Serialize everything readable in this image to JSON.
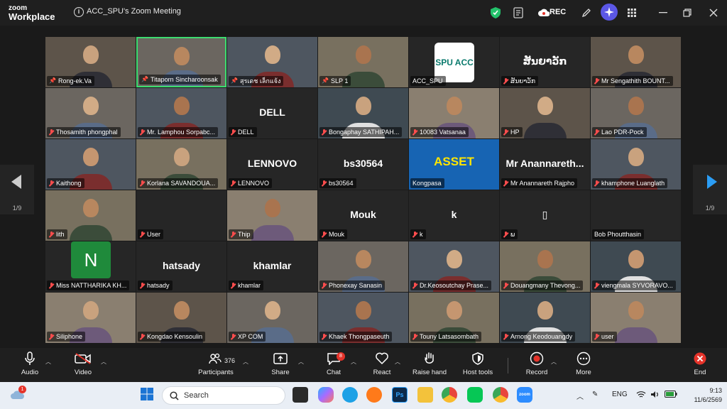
{
  "window": {
    "brand_line1": "zoom",
    "brand_line2": "Workplace",
    "meeting_title": "ACC_SPU's Zoom Meeting",
    "rec_label": "REC"
  },
  "pager": {
    "left": "1/9",
    "right": "1/9"
  },
  "tiles": [
    {
      "label": "Rong-ek.Va",
      "pinned": true,
      "video": true
    },
    {
      "label": "Titaporn Sincharoonsak",
      "pinned": true,
      "video": true,
      "active": true
    },
    {
      "label": "สุรเดช เล็กแจ้ง",
      "pinned": true,
      "video": true
    },
    {
      "label": "SLP 1",
      "pinned": true,
      "video": true
    },
    {
      "label": "ACC_SPU",
      "logo_text": "SPU ACC"
    },
    {
      "label": "ສັນຍາວັກ",
      "muted": true,
      "big_text": "ສັນຍາວັກ"
    },
    {
      "label": "Mr Sengathith BOUNT...",
      "muted": true,
      "video": true
    },
    {
      "label": "Thosamith phongphal",
      "muted": true,
      "video": true
    },
    {
      "label": "Mr. Lamphou Sorpabc...",
      "muted": true,
      "video": true
    },
    {
      "label": "DELL",
      "muted": true,
      "big_text": "DELL"
    },
    {
      "label": "Bongaphay SATHIPAH...",
      "muted": true,
      "video": true
    },
    {
      "label": "10083 Vatsanaa",
      "muted": true,
      "video": true
    },
    {
      "label": "HP",
      "muted": true,
      "video": true
    },
    {
      "label": "Lao PDR-Pock",
      "muted": true,
      "video": true
    },
    {
      "label": "Kaithong",
      "muted": true,
      "video": true
    },
    {
      "label": "Korlana SAVANDOUA...",
      "muted": true,
      "video": true
    },
    {
      "label": "LENNOVO",
      "muted": true,
      "big_text": "LENNOVO"
    },
    {
      "label": "bs30564",
      "muted": true,
      "big_text": "bs30564"
    },
    {
      "label": "Kongpasa",
      "asset_text": "ASSET"
    },
    {
      "label": "Mr Anannareth Rajpho",
      "muted": true,
      "big_text": "Mr  Anannareth..."
    },
    {
      "label": "khamphone Luanglath",
      "muted": true,
      "video": true
    },
    {
      "label": "lith",
      "muted": true,
      "video": true
    },
    {
      "label": "User",
      "muted": true
    },
    {
      "label": "Thip",
      "muted": true,
      "video": true
    },
    {
      "label": "Mouk",
      "muted": true,
      "big_text": "Mouk"
    },
    {
      "label": "k",
      "muted": true,
      "big_text": "k"
    },
    {
      "label": "ພ",
      "muted": true,
      "big_text": "▯"
    },
    {
      "label": "Bob Phoutthasin"
    },
    {
      "label": "Miss NATTHARIKA KH...",
      "muted": true,
      "avatar_letter": "N"
    },
    {
      "label": "hatsady",
      "muted": true,
      "big_text": "hatsady"
    },
    {
      "label": "khamlar",
      "muted": true,
      "big_text": "khamlar"
    },
    {
      "label": "Phonexay Sanasin",
      "muted": true,
      "video": true
    },
    {
      "label": "Dr.Keosoutchay Prase...",
      "muted": true,
      "video": true
    },
    {
      "label": "Douangmany Thevong...",
      "muted": true,
      "video": true
    },
    {
      "label": "viengmala SYVORAVO...",
      "muted": true,
      "video": true
    },
    {
      "label": "Siliphone",
      "muted": true,
      "video": true
    },
    {
      "label": "Kongdao Kensoulin",
      "muted": true,
      "video": true
    },
    {
      "label": "XP COM",
      "muted": true,
      "video": true
    },
    {
      "label": "Khaek Thongpaseuth",
      "muted": true,
      "video": true
    },
    {
      "label": "Touny Latsasombath",
      "muted": true,
      "video": true
    },
    {
      "label": "Arnong Keodouangdy",
      "muted": true,
      "video": true
    },
    {
      "label": "user",
      "muted": true,
      "video": true
    }
  ],
  "toolbar": {
    "audio": "Audio",
    "video": "Video",
    "participants": "Participants",
    "participant_count": "376",
    "share": "Share",
    "chat": "Chat",
    "chat_badge": "8",
    "react": "React",
    "raise_hand": "Raise hand",
    "host_tools": "Host tools",
    "record": "Record",
    "more": "More",
    "end": "End"
  },
  "taskbar": {
    "weather_badge": "1",
    "search_placeholder": "Search",
    "lang": "ENG",
    "time": "9:13",
    "date": "11/6/2569",
    "zoom_app_label": "zoom"
  },
  "colors": {
    "active_speaker": "#3ddc6f",
    "muted_red": "#ff4d4d",
    "record_red": "#e5332a",
    "end_red": "#e5332a",
    "page_arrow": "#2b9df4"
  }
}
